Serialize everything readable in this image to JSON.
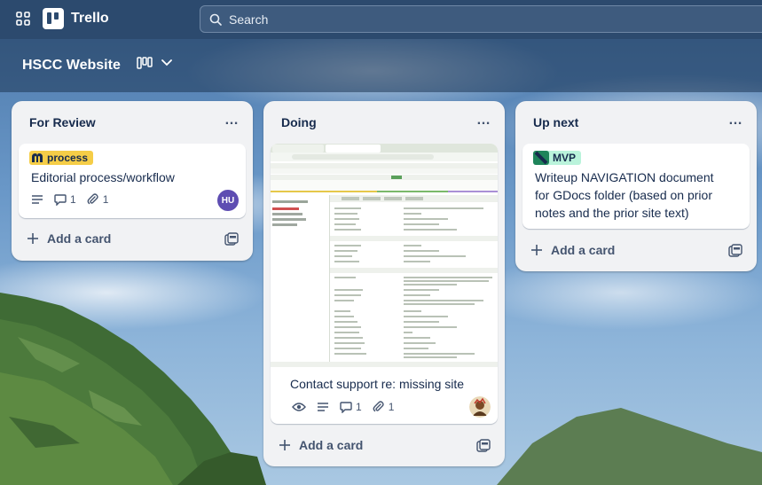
{
  "topbar": {
    "app_name": "Trello",
    "search_placeholder": "Search",
    "icons": [
      "apps-grid-icon",
      "trello-logo-icon",
      "search-icon"
    ]
  },
  "board": {
    "title": "HSCC Website",
    "view_icons": [
      "board-view-icon",
      "chevron-down-icon"
    ]
  },
  "lists": [
    {
      "title": "For Review",
      "menu": "…",
      "add_card_label": "Add a card",
      "cards": [
        {
          "label": "process",
          "label_color": "#f5cd47",
          "title": "Editorial process/workflow",
          "description_icon": "description-icon",
          "comments": "1",
          "attachments": "1",
          "member_initials": "HU",
          "member_color": "#5e4db2"
        }
      ]
    },
    {
      "title": "Doing",
      "menu": "…",
      "add_card_label": "Add a card",
      "cards": [
        {
          "cover": "browser-screenshot",
          "title": "Contact support re: missing site",
          "watch_icon": "eye-icon",
          "description_icon": "description-icon",
          "comments": "1",
          "attachments": "1",
          "member_avatar": "photo-avatar"
        }
      ]
    },
    {
      "title": "Up next",
      "menu": "…",
      "add_card_label": "Add a card",
      "cards": [
        {
          "label": "MVP",
          "label_color": "#baf3db",
          "title_lines": [
            "Writeup NAVIGATION document",
            "for GDocs folder (based on prior",
            "notes and the prior site text)"
          ]
        }
      ]
    }
  ],
  "colors": {
    "topbar": "#2c4a6e",
    "list_bg": "#f1f2f4",
    "text": "#172b4d",
    "muted": "#44546f"
  }
}
